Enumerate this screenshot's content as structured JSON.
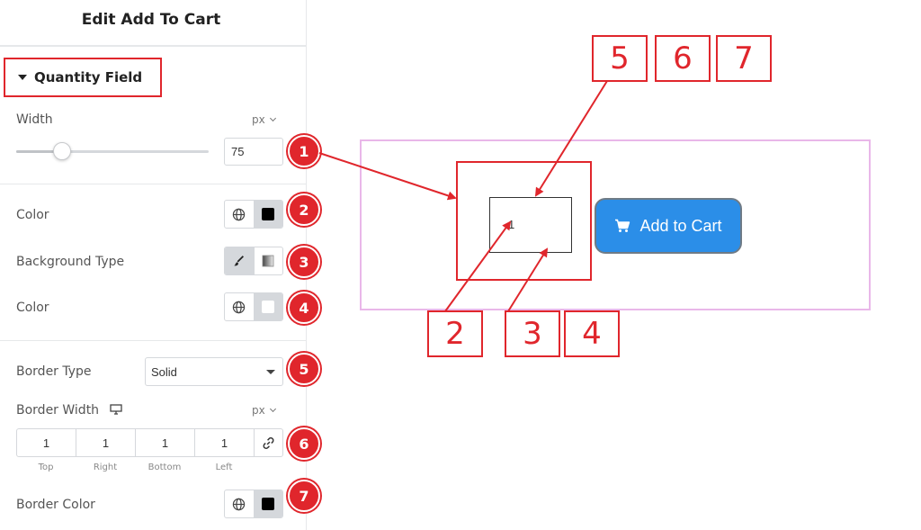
{
  "panel": {
    "title": "Edit Add To Cart",
    "section": "Quantity Field",
    "width": {
      "label": "Width",
      "unit": "px",
      "value": "75",
      "slider_fraction": 0.24
    },
    "color": {
      "label": "Color"
    },
    "background_type": {
      "label": "Background Type"
    },
    "bg_color": {
      "label": "Color"
    },
    "border_type": {
      "label": "Border Type",
      "value": "Solid"
    },
    "border_width": {
      "label": "Border Width",
      "unit": "px",
      "values": [
        "1",
        "1",
        "1",
        "1"
      ],
      "sides": [
        "Top",
        "Right",
        "Bottom",
        "Left"
      ]
    },
    "border_color": {
      "label": "Border Color"
    }
  },
  "badges": [
    "1",
    "2",
    "3",
    "4",
    "5",
    "6",
    "7"
  ],
  "preview": {
    "quantity_value": "1",
    "button_label": "Add to Cart"
  },
  "callouts": {
    "top": [
      "5",
      "6",
      "7"
    ],
    "bottom": [
      "2",
      "3",
      "4"
    ]
  },
  "colors": {
    "accent_red": "#e0262c",
    "button_blue": "#2b8ee8",
    "preview_border": "#e9b7e9",
    "text_color_swatch": "#000000",
    "bg_color_swatch": "#ffffff",
    "border_color_swatch": "#000000"
  }
}
